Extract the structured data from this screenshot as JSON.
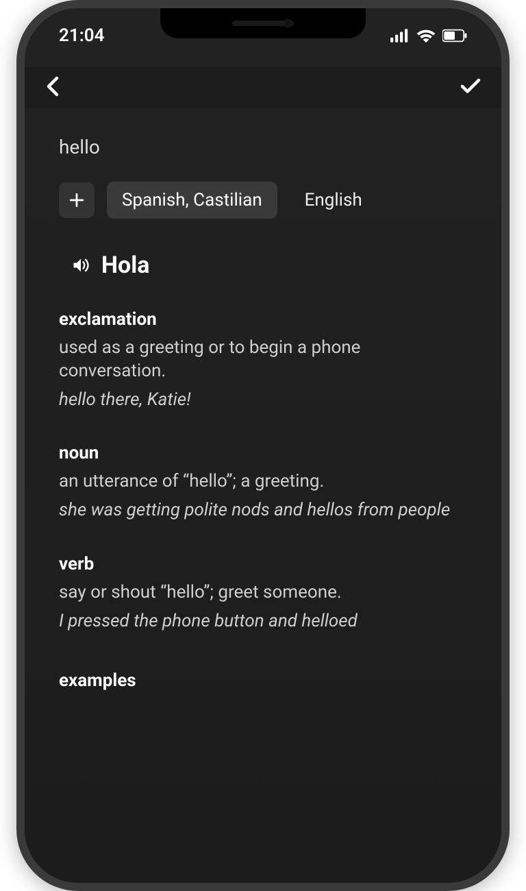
{
  "status": {
    "time": "21:04"
  },
  "word": "hello",
  "languages": {
    "active": "Spanish, Castilian",
    "inactive": "English"
  },
  "translation": "Hola",
  "definitions": [
    {
      "pos": "exclamation",
      "text": "used as a greeting or to begin a phone conversation.",
      "example": "hello there, Katie!"
    },
    {
      "pos": "noun",
      "text": "an utterance of “hello”; a greeting.",
      "example": "she was getting polite nods and hellos from people"
    },
    {
      "pos": "verb",
      "text": "say or shout “hello”; greet someone.",
      "example": "I pressed the phone button and helloed"
    }
  ],
  "sections": {
    "examples": "examples"
  }
}
